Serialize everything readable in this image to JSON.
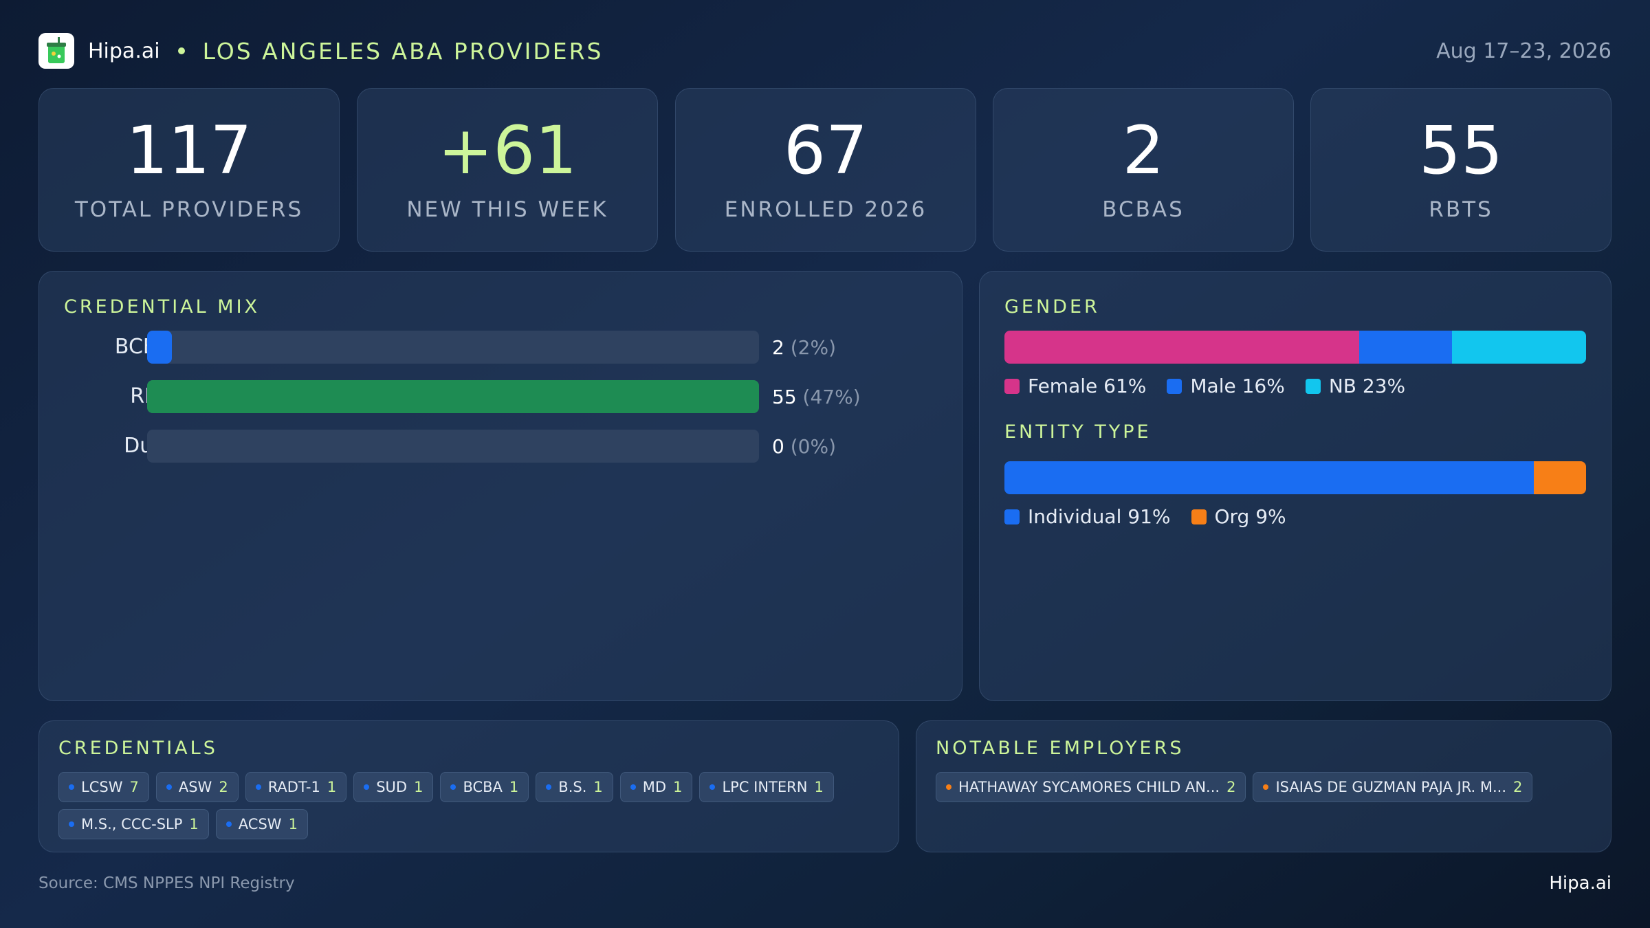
{
  "header": {
    "brand": "Hipa.ai",
    "title": "LOS ANGELES ABA PROVIDERS",
    "date_range": "Aug 17–23, 2026"
  },
  "stats": [
    {
      "value": "117",
      "label": "TOTAL PROVIDERS"
    },
    {
      "value": "+61",
      "label": "NEW THIS WEEK"
    },
    {
      "value": "67",
      "label": "ENROLLED 2026"
    },
    {
      "value": "2",
      "label": "BCBAS"
    },
    {
      "value": "55",
      "label": "RBTS"
    }
  ],
  "credential_mix": {
    "title": "CREDENTIAL MIX",
    "rows": [
      {
        "label": "BCBA",
        "count": "2",
        "pct": "(2%)",
        "fraction": 0.04,
        "color": "#1a6df2"
      },
      {
        "label": "RBT",
        "count": "55",
        "pct": "(47%)",
        "fraction": 1.0,
        "color": "#1e8c53"
      },
      {
        "label": "Dual",
        "count": "0",
        "pct": "(0%)",
        "fraction": 0.0,
        "color": "#1a6df2"
      }
    ]
  },
  "gender": {
    "title": "GENDER",
    "segments": [
      {
        "label": "Female 61%",
        "fraction": 0.61,
        "color": "#d6348a"
      },
      {
        "label": "Male 16%",
        "fraction": 0.16,
        "color": "#1a6df2"
      },
      {
        "label": "NB 23%",
        "fraction": 0.23,
        "color": "#12c6ee"
      }
    ]
  },
  "entity_type": {
    "title": "ENTITY TYPE",
    "segments": [
      {
        "label": "Individual 91%",
        "fraction": 0.91,
        "color": "#1a6df2"
      },
      {
        "label": "Org 9%",
        "fraction": 0.09,
        "color": "#f77f17"
      }
    ]
  },
  "credentials": {
    "title": "CREDENTIALS",
    "dot_color": "#1a6df2",
    "chips": [
      {
        "name": "LCSW",
        "count": "7"
      },
      {
        "name": "ASW",
        "count": "2"
      },
      {
        "name": "RADT-1",
        "count": "1"
      },
      {
        "name": "SUD",
        "count": "1"
      },
      {
        "name": "BCBA",
        "count": "1"
      },
      {
        "name": "B.S.",
        "count": "1"
      },
      {
        "name": "MD",
        "count": "1"
      },
      {
        "name": "LPC INTERN",
        "count": "1"
      },
      {
        "name": "M.S., CCC-SLP",
        "count": "1"
      },
      {
        "name": "ACSW",
        "count": "1"
      }
    ]
  },
  "employers": {
    "title": "NOTABLE EMPLOYERS",
    "dot_color": "#f77f17",
    "chips": [
      {
        "name": "HATHAWAY SYCAMORES CHILD AN...",
        "count": "2"
      },
      {
        "name": "ISAIAS DE GUZMAN PAJA JR. M...",
        "count": "2"
      }
    ]
  },
  "footer": {
    "source": "Source: CMS NPPES NPI Registry",
    "brand": "Hipa.ai"
  }
}
